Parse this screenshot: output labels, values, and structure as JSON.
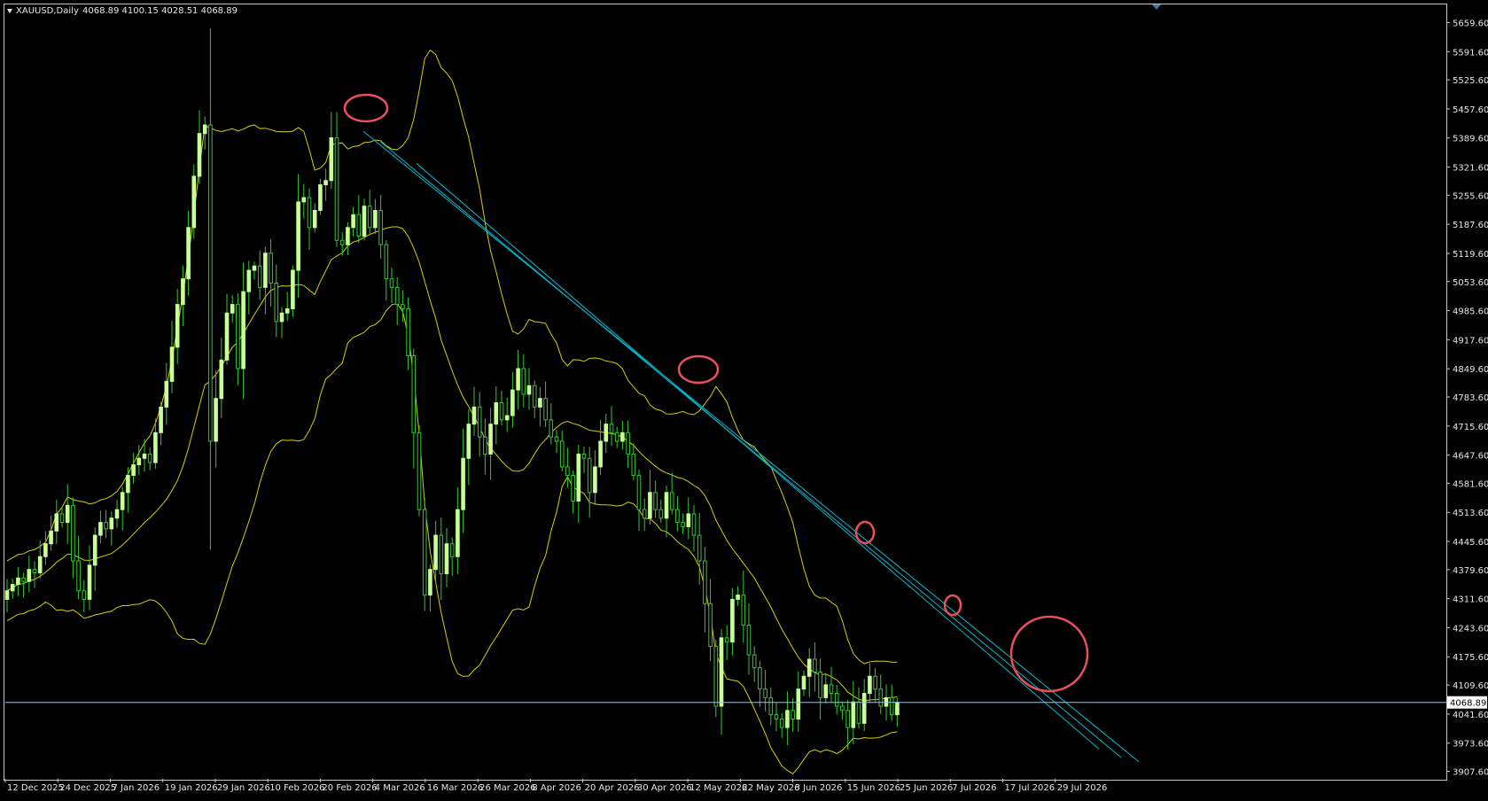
{
  "header": {
    "symbol": "XAUUSD,Daily",
    "ohlc": "4068.89 4100.15 4028.51 4068.89"
  },
  "colors": {
    "background": "#000000",
    "frame": "#c8c8c8",
    "bull_body": "#c8ff96",
    "wick": "#32c832",
    "bollinger": "#d2d200",
    "trendline": "#00bcd4",
    "bid_line": "#9ec3d6",
    "highlight_circle": "#e8505b",
    "text": "#e6e6e6"
  },
  "chart_data": {
    "type": "candlestick",
    "symbol": "XAUUSD",
    "timeframe": "Daily",
    "last_price": 4068.89,
    "ohlc_header": {
      "open": 4068.89,
      "high": 4100.15,
      "low": 4028.51,
      "close": 4068.89
    },
    "ylim": [
      3890,
      5700
    ],
    "y_ticks": [
      "5659.60",
      "5591.60",
      "5525.60",
      "5457.60",
      "5389.60",
      "5321.60",
      "5255.60",
      "5187.60",
      "5119.60",
      "5053.60",
      "4985.60",
      "4917.60",
      "4849.60",
      "4783.60",
      "4715.60",
      "4647.60",
      "4581.60",
      "4513.60",
      "4445.60",
      "4379.60",
      "4311.60",
      "4243.60",
      "4175.60",
      "4109.60",
      "4041.60",
      "3973.60",
      "3907.60"
    ],
    "x_ticks": [
      "12 Dec 2025",
      "24 Dec 2025",
      "7 Jan 2026",
      "19 Jan 2026",
      "29 Jan 2026",
      "10 Feb 2026",
      "20 Feb 2026",
      "4 Mar 2026",
      "16 Mar 2026",
      "26 Mar 2026",
      "8 Apr 2026",
      "20 Apr 2026",
      "30 Apr 2026",
      "12 May 2026",
      "22 May 2026",
      "3 Jun 2026",
      "15 Jun 2026",
      "25 Jun 2026",
      "7 Jul 2026",
      "17 Jul 2026",
      "29 Jul 2026"
    ],
    "close_series": [
      4330,
      4345,
      4360,
      4352,
      4380,
      4372,
      4410,
      4440,
      4470,
      4510,
      4490,
      4530,
      4400,
      4330,
      4310,
      4390,
      4460,
      4490,
      4475,
      4500,
      4520,
      4560,
      4600,
      4625,
      4640,
      4650,
      4630,
      4700,
      4760,
      4820,
      4900,
      5000,
      5060,
      5180,
      5300,
      5400,
      5420,
      4680,
      4780,
      4870,
      4980,
      5000,
      4850,
      5030,
      5080,
      5090,
      5040,
      5120,
      5050,
      4960,
      4980,
      4990,
      5080,
      5240,
      5250,
      5180,
      5220,
      5280,
      5290,
      5390,
      5150,
      5140,
      5180,
      5210,
      5160,
      5230,
      5180,
      5220,
      5140,
      5060,
      5040,
      5000,
      4990,
      4880,
      4700,
      4520,
      4320,
      4380,
      4460,
      4370,
      4440,
      4410,
      4520,
      4640,
      4720,
      4760,
      4690,
      4650,
      4720,
      4770,
      4730,
      4740,
      4800,
      4850,
      4790,
      4810,
      4760,
      4780,
      4730,
      4690,
      4680,
      4620,
      4600,
      4540,
      4650,
      4640,
      4560,
      4620,
      4680,
      4720,
      4700,
      4680,
      4700,
      4650,
      4600,
      4520,
      4500,
      4560,
      4520,
      4500,
      4560,
      4520,
      4490,
      4480,
      4510,
      4460,
      4400,
      4300,
      4200,
      4060,
      4220,
      4210,
      4310,
      4320,
      4250,
      4180,
      4150,
      4100,
      4080,
      4040,
      4030,
      4010,
      4050,
      4030,
      4100,
      4130,
      4170,
      4140,
      4080,
      4110,
      4090,
      4060,
      4050,
      4010,
      4070,
      4020,
      4090,
      4130,
      4100,
      4060,
      4080,
      4040,
      4068.89
    ],
    "annotations": {
      "trendlines": 3,
      "highlight_circles": 5,
      "indicator": "Bollinger Bands"
    },
    "grid": false
  }
}
